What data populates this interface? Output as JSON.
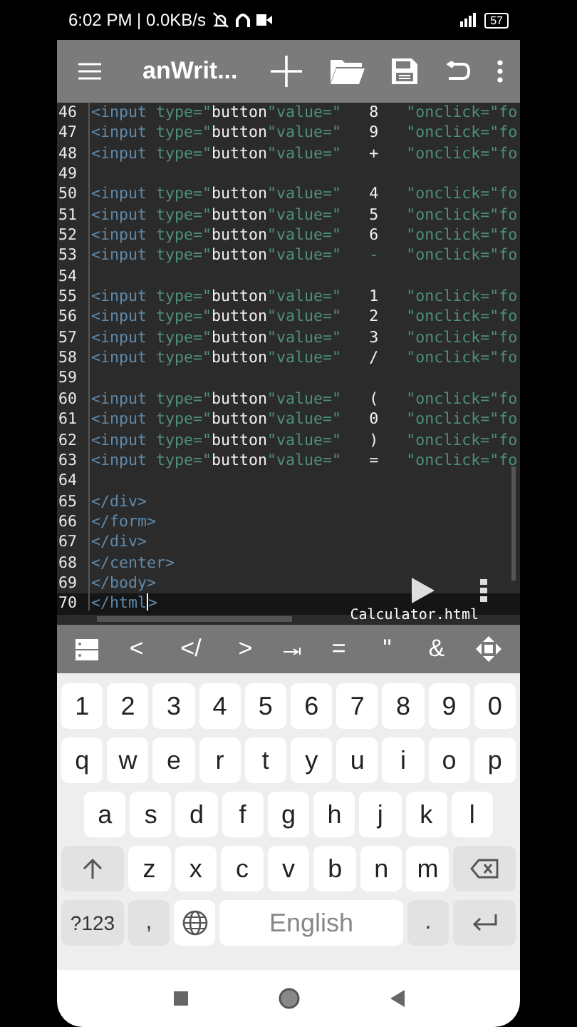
{
  "status_bar": {
    "time": "6:02 PM | 0.0KB/s",
    "battery": "57"
  },
  "app_bar": {
    "title": "anWrit...",
    "actions": [
      {
        "kind": "plus"
      },
      {
        "kind": "folder"
      },
      {
        "kind": "save"
      },
      {
        "kind": "undo"
      },
      {
        "kind": "more"
      }
    ]
  },
  "editor": {
    "lines": [
      {
        "number": "46",
        "current": false,
        "tokens": [
          {
            "text": "<input",
            "kind": "tag"
          },
          {
            "text": " type=\"",
            "kind": "attr"
          },
          {
            "text": "button",
            "kind": "str"
          },
          {
            "text": "\"value=\"",
            "kind": "attr"
          },
          {
            "text": "   8   ",
            "kind": "str"
          },
          {
            "text": "\"onclick=\"fo",
            "kind": "attr"
          }
        ]
      },
      {
        "number": "47",
        "current": false,
        "tokens": [
          {
            "text": "<input",
            "kind": "tag"
          },
          {
            "text": " type=\"",
            "kind": "attr"
          },
          {
            "text": "button",
            "kind": "str"
          },
          {
            "text": "\"value=\"",
            "kind": "attr"
          },
          {
            "text": "   9   ",
            "kind": "str"
          },
          {
            "text": "\"onclick=\"fo",
            "kind": "attr"
          }
        ]
      },
      {
        "number": "48",
        "current": false,
        "tokens": [
          {
            "text": "<input",
            "kind": "tag"
          },
          {
            "text": " type=\"",
            "kind": "attr"
          },
          {
            "text": "button",
            "kind": "str"
          },
          {
            "text": "\"value=\"",
            "kind": "attr"
          },
          {
            "text": "   +   ",
            "kind": "str"
          },
          {
            "text": "\"onclick=\"fo",
            "kind": "attr"
          }
        ]
      },
      {
        "number": "49",
        "current": false
      },
      {
        "number": "50",
        "current": false,
        "tokens": [
          {
            "text": "<input",
            "kind": "tag"
          },
          {
            "text": " type=\"",
            "kind": "attr"
          },
          {
            "text": "button",
            "kind": "str"
          },
          {
            "text": "\"value=\"",
            "kind": "attr"
          },
          {
            "text": "   4   ",
            "kind": "str"
          },
          {
            "text": "\"onclick=\"fo",
            "kind": "attr"
          }
        ]
      },
      {
        "number": "51",
        "current": false,
        "tokens": [
          {
            "text": "<input",
            "kind": "tag"
          },
          {
            "text": " type=\"",
            "kind": "attr"
          },
          {
            "text": "button",
            "kind": "str"
          },
          {
            "text": "\"value=\"",
            "kind": "attr"
          },
          {
            "text": "   5   ",
            "kind": "str"
          },
          {
            "text": "\"onclick=\"fo",
            "kind": "attr"
          }
        ]
      },
      {
        "number": "52",
        "current": false,
        "tokens": [
          {
            "text": "<input",
            "kind": "tag"
          },
          {
            "text": " type=\"",
            "kind": "attr"
          },
          {
            "text": "button",
            "kind": "str"
          },
          {
            "text": "\"value=\"",
            "kind": "attr"
          },
          {
            "text": "   6   ",
            "kind": "str"
          },
          {
            "text": "\"onclick=\"fo",
            "kind": "attr"
          }
        ]
      },
      {
        "number": "53",
        "current": false,
        "tokens": [
          {
            "text": "<input",
            "kind": "tag"
          },
          {
            "text": " type=\"",
            "kind": "attr"
          },
          {
            "text": "button",
            "kind": "str"
          },
          {
            "text": "\"value=\"",
            "kind": "attr"
          },
          {
            "text": "   -   ",
            "kind": "attr"
          },
          {
            "text": "\"onclick=\"fo",
            "kind": "attr"
          }
        ]
      },
      {
        "number": "54",
        "current": false
      },
      {
        "number": "55",
        "current": false,
        "tokens": [
          {
            "text": "<input",
            "kind": "tag"
          },
          {
            "text": " type=\"",
            "kind": "attr"
          },
          {
            "text": "button",
            "kind": "str"
          },
          {
            "text": "\"value=\"",
            "kind": "attr"
          },
          {
            "text": "   1   ",
            "kind": "str"
          },
          {
            "text": "\"onclick=\"fo",
            "kind": "attr"
          }
        ]
      },
      {
        "number": "56",
        "current": false,
        "tokens": [
          {
            "text": "<input",
            "kind": "tag"
          },
          {
            "text": " type=\"",
            "kind": "attr"
          },
          {
            "text": "button",
            "kind": "str"
          },
          {
            "text": "\"value=\"",
            "kind": "attr"
          },
          {
            "text": "   2   ",
            "kind": "str"
          },
          {
            "text": "\"onclick=\"fo",
            "kind": "attr"
          }
        ]
      },
      {
        "number": "57",
        "current": false,
        "tokens": [
          {
            "text": "<input",
            "kind": "tag"
          },
          {
            "text": " type=\"",
            "kind": "attr"
          },
          {
            "text": "button",
            "kind": "str"
          },
          {
            "text": "\"value=\"",
            "kind": "attr"
          },
          {
            "text": "   3   ",
            "kind": "str"
          },
          {
            "text": "\"onclick=\"fo",
            "kind": "attr"
          }
        ]
      },
      {
        "number": "58",
        "current": false,
        "tokens": [
          {
            "text": "<input",
            "kind": "tag"
          },
          {
            "text": " type=\"",
            "kind": "attr"
          },
          {
            "text": "button",
            "kind": "str"
          },
          {
            "text": "\"value=\"",
            "kind": "attr"
          },
          {
            "text": "   /   ",
            "kind": "str"
          },
          {
            "text": "\"onclick=\"fo",
            "kind": "attr"
          }
        ]
      },
      {
        "number": "59",
        "current": false
      },
      {
        "number": "60",
        "current": false,
        "tokens": [
          {
            "text": "<input",
            "kind": "tag"
          },
          {
            "text": " type=\"",
            "kind": "attr"
          },
          {
            "text": "button",
            "kind": "str"
          },
          {
            "text": "\"value=\"",
            "kind": "attr"
          },
          {
            "text": "   (   ",
            "kind": "str"
          },
          {
            "text": "\"onclick=\"fo",
            "kind": "attr"
          }
        ]
      },
      {
        "number": "61",
        "current": false,
        "tokens": [
          {
            "text": "<input",
            "kind": "tag"
          },
          {
            "text": " type=\"",
            "kind": "attr"
          },
          {
            "text": "button",
            "kind": "str"
          },
          {
            "text": "\"value=\"",
            "kind": "attr"
          },
          {
            "text": "   0   ",
            "kind": "str"
          },
          {
            "text": "\"onclick=\"fo",
            "kind": "attr"
          }
        ]
      },
      {
        "number": "62",
        "current": false,
        "tokens": [
          {
            "text": "<input",
            "kind": "tag"
          },
          {
            "text": " type=\"",
            "kind": "attr"
          },
          {
            "text": "button",
            "kind": "str"
          },
          {
            "text": "\"value=\"",
            "kind": "attr"
          },
          {
            "text": "   )   ",
            "kind": "str"
          },
          {
            "text": "\"onclick=\"fo",
            "kind": "attr"
          }
        ]
      },
      {
        "number": "63",
        "current": false,
        "tokens": [
          {
            "text": "<input",
            "kind": "tag"
          },
          {
            "text": " type=\"",
            "kind": "attr"
          },
          {
            "text": "button",
            "kind": "str"
          },
          {
            "text": "\"value=\"",
            "kind": "attr"
          },
          {
            "text": "   =   ",
            "kind": "str"
          },
          {
            "text": "\"onclick=\"fo",
            "kind": "attr"
          }
        ]
      },
      {
        "number": "64",
        "current": false
      },
      {
        "number": "65",
        "current": false,
        "tokens": [
          {
            "text": "</div>",
            "kind": "tag"
          }
        ]
      },
      {
        "number": "66",
        "current": false,
        "tokens": [
          {
            "text": "</form>",
            "kind": "tag"
          }
        ]
      },
      {
        "number": "67",
        "current": false,
        "tokens": [
          {
            "text": "</div>",
            "kind": "tag"
          }
        ]
      },
      {
        "number": "68",
        "current": false,
        "tokens": [
          {
            "text": "</center>",
            "kind": "tag"
          }
        ]
      },
      {
        "number": "69",
        "current": false,
        "tokens": [
          {
            "text": "</body>",
            "kind": "tag"
          }
        ]
      },
      {
        "number": "70",
        "current": true,
        "tokens": [
          {
            "text": "</html",
            "kind": "tag"
          },
          {
            "text": ">",
            "kind": "tag"
          }
        ]
      }
    ],
    "file_name": "Calculator.html"
  },
  "extra_keys": [
    {
      "kind": "list"
    },
    {
      "kind": "text",
      "text": "<"
    },
    {
      "kind": "text",
      "text": "</"
    },
    {
      "kind": "text",
      "text": ">"
    },
    {
      "kind": "tab"
    },
    {
      "kind": "text",
      "text": "="
    },
    {
      "kind": "text",
      "text": "\""
    },
    {
      "kind": "text",
      "text": "&"
    },
    {
      "kind": "move"
    }
  ],
  "keyboard": {
    "number_row": [
      {
        "kind": "char",
        "text": "1"
      },
      {
        "kind": "char",
        "text": "2"
      },
      {
        "kind": "char",
        "text": "3"
      },
      {
        "kind": "char",
        "text": "4"
      },
      {
        "kind": "char",
        "text": "5"
      },
      {
        "kind": "char",
        "text": "6"
      },
      {
        "kind": "char",
        "text": "7"
      },
      {
        "kind": "char",
        "text": "8"
      },
      {
        "kind": "char",
        "text": "9"
      },
      {
        "kind": "char",
        "text": "0"
      }
    ],
    "top_row": [
      {
        "kind": "char",
        "text": "q"
      },
      {
        "kind": "char",
        "text": "w"
      },
      {
        "kind": "char",
        "text": "e"
      },
      {
        "kind": "char",
        "text": "r"
      },
      {
        "kind": "char",
        "text": "t"
      },
      {
        "kind": "char",
        "text": "y"
      },
      {
        "kind": "char",
        "text": "u"
      },
      {
        "kind": "char",
        "text": "i"
      },
      {
        "kind": "char",
        "text": "o"
      },
      {
        "kind": "char",
        "text": "p"
      }
    ],
    "middle_row": [
      {
        "kind": "char",
        "text": "a"
      },
      {
        "kind": "char",
        "text": "s"
      },
      {
        "kind": "char",
        "text": "d"
      },
      {
        "kind": "char",
        "text": "f"
      },
      {
        "kind": "char",
        "text": "g"
      },
      {
        "kind": "char",
        "text": "h"
      },
      {
        "kind": "char",
        "text": "j"
      },
      {
        "kind": "char",
        "text": "k"
      },
      {
        "kind": "char",
        "text": "l"
      }
    ],
    "bottom_row": [
      {
        "kind": "shift"
      },
      {
        "kind": "char",
        "text": "z"
      },
      {
        "kind": "char",
        "text": "x"
      },
      {
        "kind": "char",
        "text": "c"
      },
      {
        "kind": "char",
        "text": "v"
      },
      {
        "kind": "char",
        "text": "b"
      },
      {
        "kind": "char",
        "text": "n"
      },
      {
        "kind": "char",
        "text": "m"
      },
      {
        "kind": "backspace"
      }
    ],
    "function_row": [
      {
        "kind": "mode",
        "text": "?123"
      },
      {
        "kind": "punct",
        "text": ","
      },
      {
        "kind": "globe"
      },
      {
        "kind": "space",
        "text": "English"
      },
      {
        "kind": "punct",
        "text": "."
      },
      {
        "kind": "enter"
      }
    ]
  }
}
